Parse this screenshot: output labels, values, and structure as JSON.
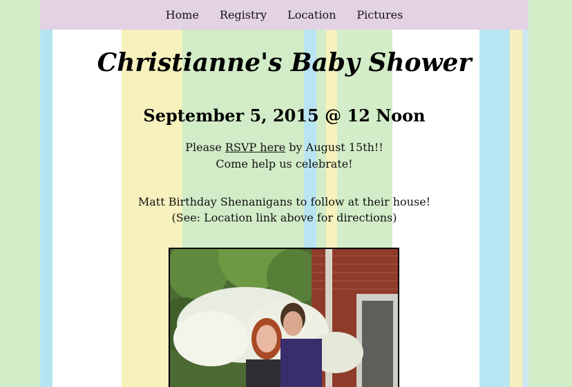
{
  "nav": {
    "items": [
      {
        "label": "Home"
      },
      {
        "label": "Registry"
      },
      {
        "label": "Location"
      },
      {
        "label": "Pictures"
      }
    ]
  },
  "main": {
    "title": "Christianne's Baby Shower",
    "date": "September 5, 2015 @ 12 Noon",
    "rsvp_prefix": "Please ",
    "rsvp_link": "RSVP here",
    "rsvp_suffix": " by August 15th!!",
    "line2": "Come help us celebrate!",
    "line3": "Matt Birthday Shenanigans to follow at their house!",
    "line4": "(See: Location link above for directions)"
  },
  "colors": {
    "background_green": "#d3edc8",
    "nav_purple": "#e3d2e4",
    "stripe_blue": "#b8e5f1",
    "stripe_yellow": "#f6f1bd"
  }
}
